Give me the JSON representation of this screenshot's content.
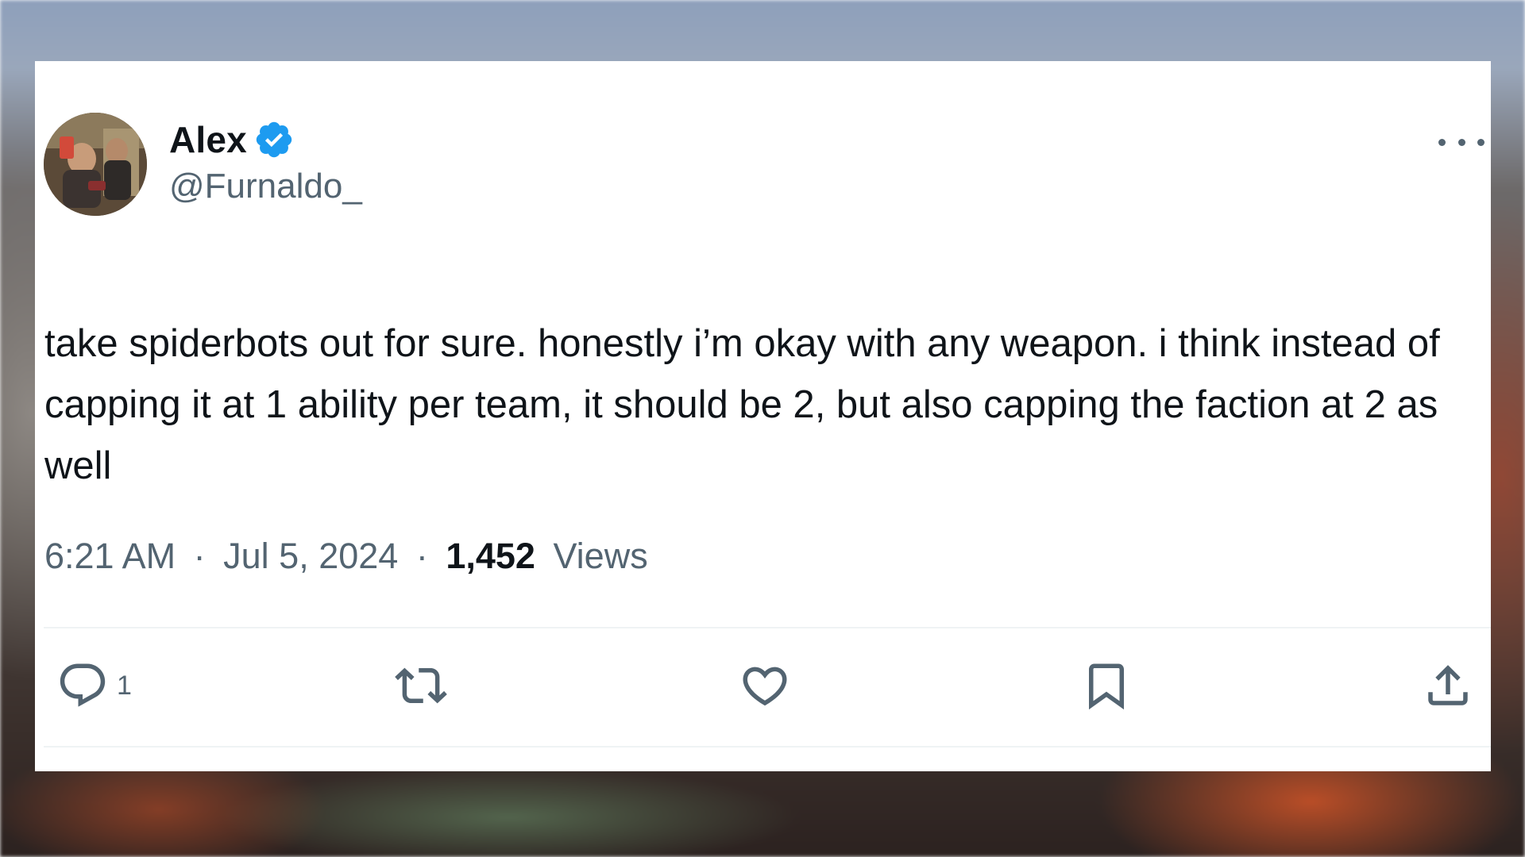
{
  "tweet": {
    "author": {
      "display_name": "Alex",
      "handle": "@Furnaldo_",
      "verified_icon": "verified-badge-icon",
      "verified_color": "#1d9bf0"
    },
    "text": "take spiderbots out for sure. honestly i’m okay with any weapon. i think instead of capping it at 1 ability per team, it should be 2, but also capping the faction at 2 as well",
    "timestamp_time": "6:21 AM",
    "separator": "·",
    "timestamp_date": "Jul 5, 2024",
    "views_count": "1,452",
    "views_label": "Views",
    "actions": {
      "reply": {
        "icon": "reply-icon",
        "count": "1"
      },
      "retweet": {
        "icon": "retweet-icon"
      },
      "like": {
        "icon": "heart-icon"
      },
      "bookmark": {
        "icon": "bookmark-icon"
      },
      "share": {
        "icon": "share-icon"
      }
    },
    "more_icon": "more-options-icon"
  },
  "colors": {
    "text_primary": "#0f1419",
    "text_secondary": "#536471",
    "divider": "#eff3f4",
    "accent": "#1d9bf0"
  }
}
